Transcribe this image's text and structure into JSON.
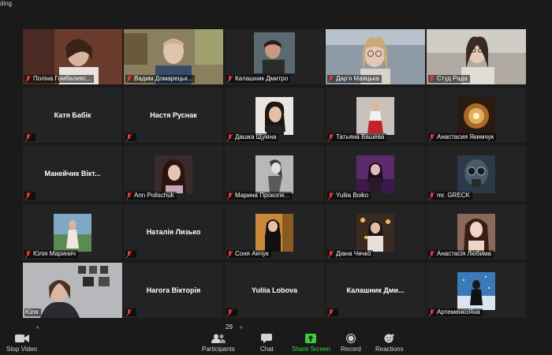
{
  "recording_label": "ding",
  "participants": [
    {
      "name": "Поліна Гомбалевс..."
    },
    {
      "name": "Вадим Домарецьк..."
    },
    {
      "name": "Калашник Дмитро"
    },
    {
      "name": "Дар'я Маяцька"
    },
    {
      "name": "Студ Рада"
    },
    {
      "center": "Катя Бабік"
    },
    {
      "center": "Настя Руснак"
    },
    {
      "name": "Дашка Щукіна"
    },
    {
      "name": "Татьяна Вашева"
    },
    {
      "name": "Анастасия Якимчук"
    },
    {
      "center": "Манейчик Вікт..."
    },
    {
      "name": "Ann Polischuk"
    },
    {
      "name": "Марина Прокопе..."
    },
    {
      "name": "Yuliia Boiko"
    },
    {
      "name": "mr. GRECK"
    },
    {
      "name": "Юлія Маринич"
    },
    {
      "center": "Наталія Лизько"
    },
    {
      "name": "Соня Анчук"
    },
    {
      "name": "Діана Чечко"
    },
    {
      "name": "Анастасія Любима"
    },
    {
      "name": "Юля"
    },
    {
      "center": "Нагога Вікторія"
    },
    {
      "center": "Yuliia Lobova"
    },
    {
      "center": "Калашник Дми..."
    },
    {
      "name": "АртеменкоЯна"
    }
  ],
  "toolbar": {
    "stop_video": "Stop Video",
    "participants": "Participants",
    "participants_count": "29",
    "chat": "Chat",
    "share_screen": "Share Screen",
    "record": "Record",
    "reactions": "Reactions"
  },
  "colors": {
    "active_speaker": "#d6e84a",
    "share_green": "#3bcf3b",
    "muted_red": "#e23b3b"
  }
}
